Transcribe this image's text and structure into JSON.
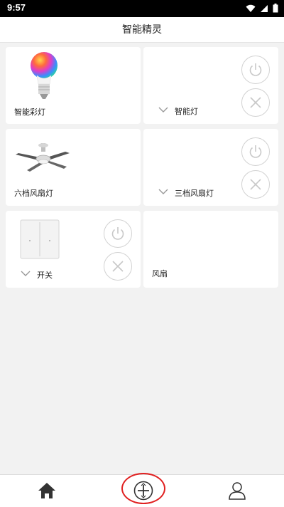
{
  "status_bar": {
    "time": "9:57"
  },
  "header": {
    "title": "智能精灵"
  },
  "devices": [
    {
      "name": "智能彩灯"
    },
    {
      "name": "智能灯"
    },
    {
      "name": "六档风扇灯"
    },
    {
      "name": "三档风扇灯"
    },
    {
      "name": "开关"
    },
    {
      "name": "风扇"
    }
  ],
  "icons": {
    "power": "power-icon",
    "close": "close-icon",
    "chevron": "chevron-down-icon",
    "home": "home-icon",
    "add": "add-icon",
    "profile": "profile-icon"
  },
  "colors": {
    "accent_ring": "#e02020",
    "icon_gray": "#c8c8c8",
    "nav_dark": "#333333"
  }
}
